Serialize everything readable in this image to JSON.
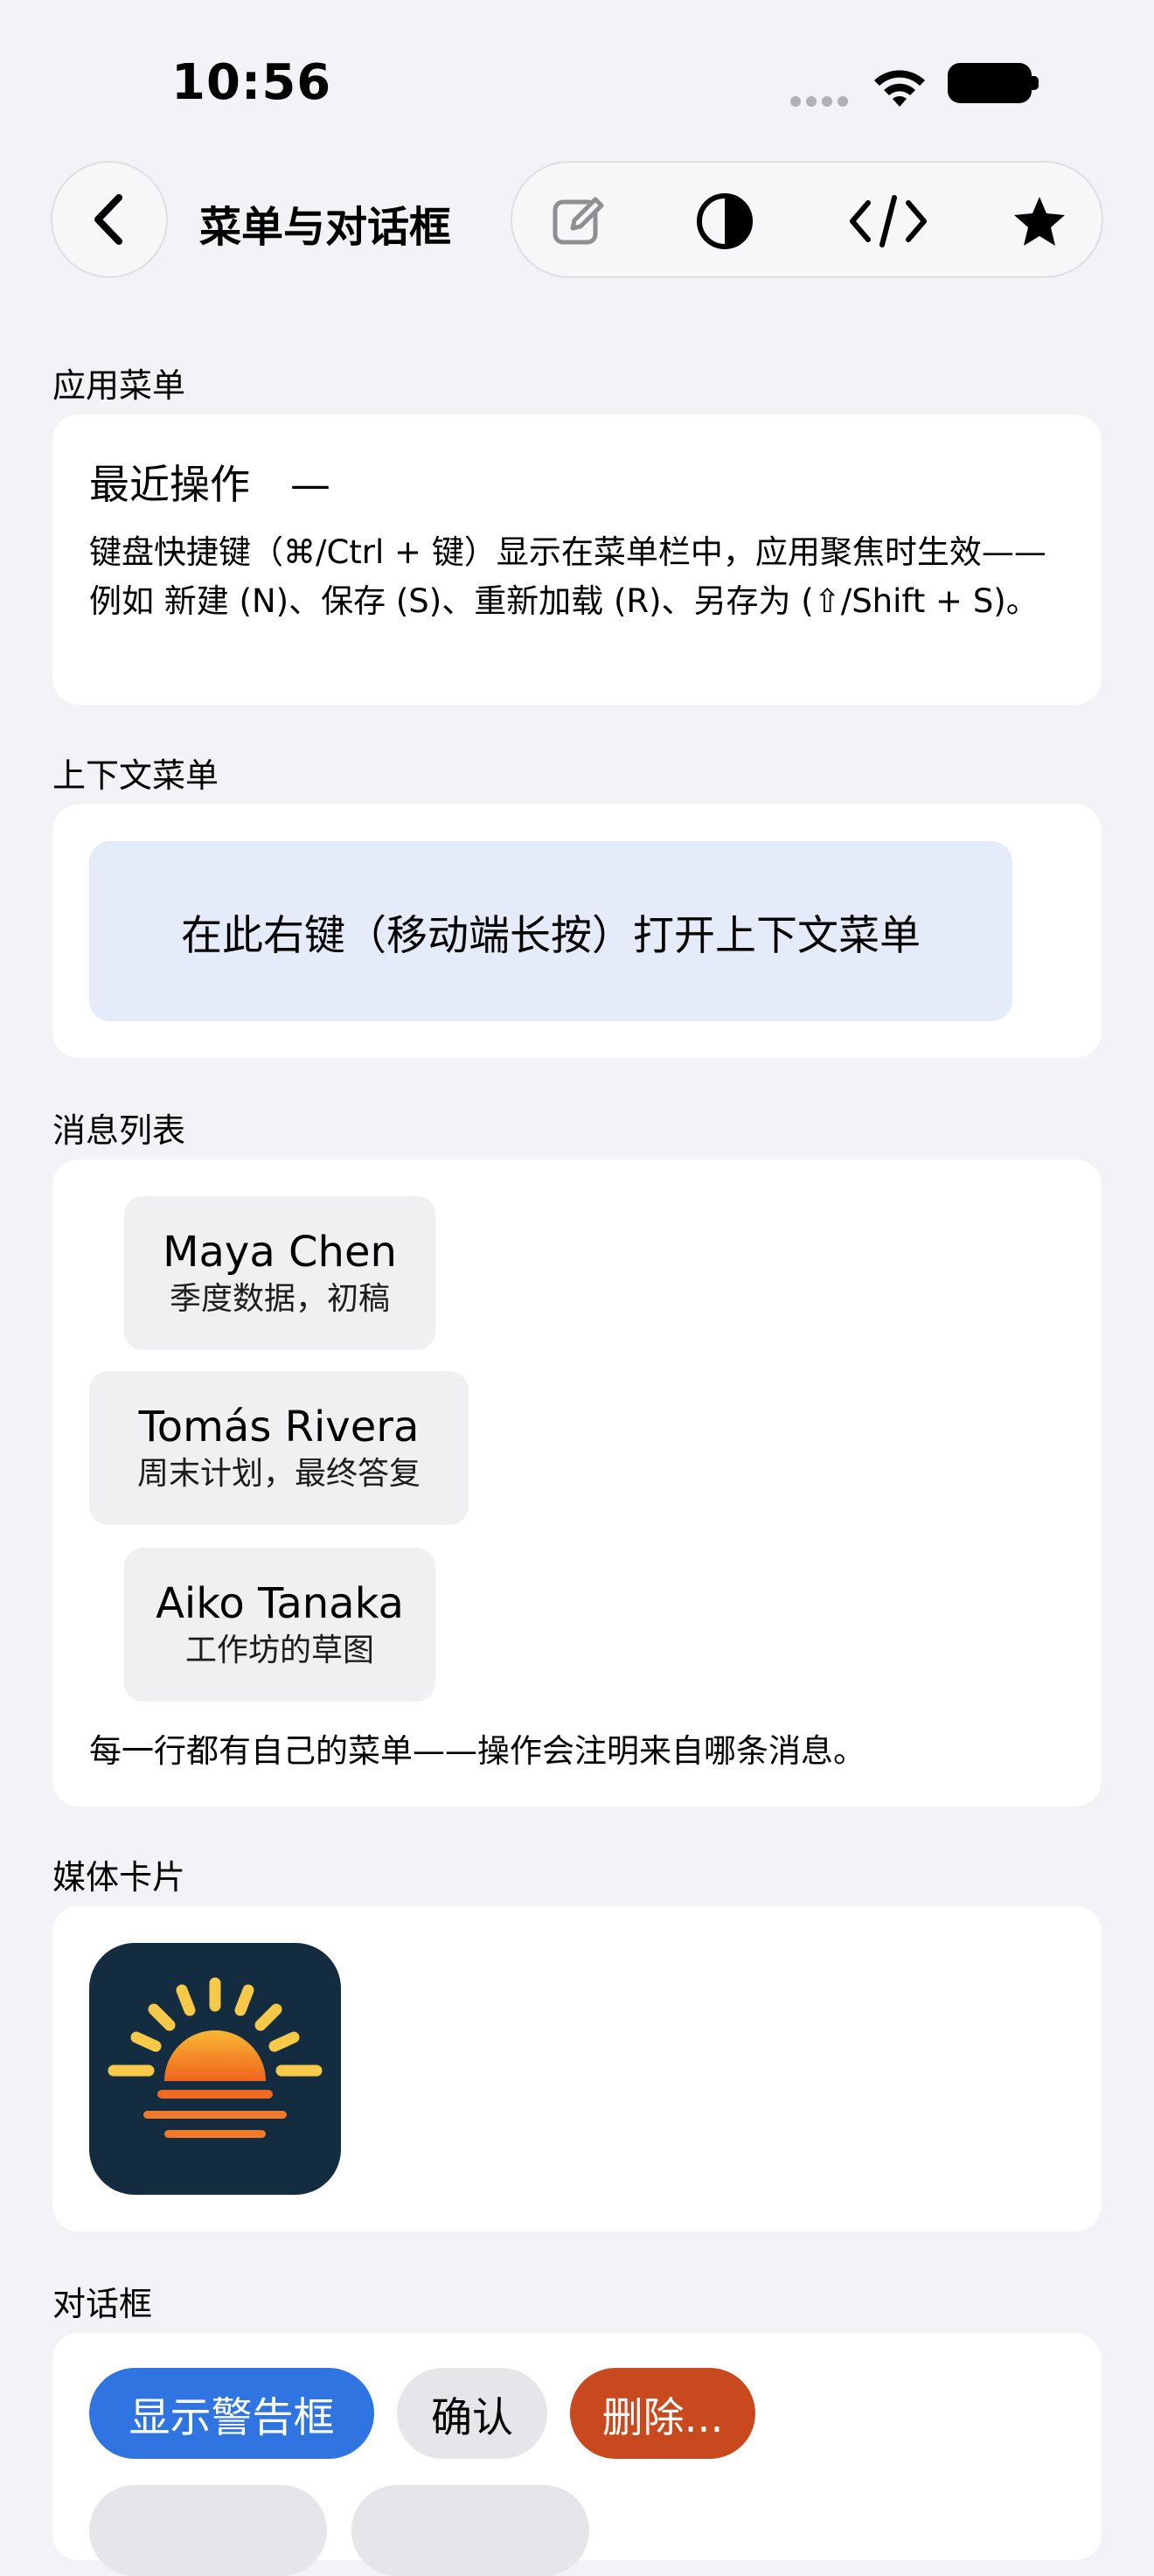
{
  "status_bar": {
    "time": "10:56"
  },
  "nav": {
    "title": "菜单与对话框",
    "back_icon": "chevron-left-icon",
    "toolbar_icons": [
      "edit-icon",
      "contrast-icon",
      "code-icon",
      "star-icon"
    ]
  },
  "sections": {
    "app_menu": {
      "label": "应用菜单",
      "recent_title": "最近操作　—",
      "description": "键盘快捷键（⌘/Ctrl + 键）显示在菜单栏中，应用聚焦时生效——例如 新建 (N)、保存 (S)、重新加载 (R)、另存为 (⇧/Shift + S)。"
    },
    "context_menu": {
      "label": "上下文菜单",
      "area_text": "在此右键（移动端长按）打开上下文菜单"
    },
    "message_list": {
      "label": "消息列表",
      "messages": [
        {
          "name": "Maya Chen",
          "subject": "季度数据，初稿"
        },
        {
          "name": "Tomás Rivera",
          "subject": "周末计划，最终答复"
        },
        {
          "name": "Aiko Tanaka",
          "subject": "工作坊的草图"
        }
      ],
      "note": "每一行都有自己的菜单——操作会注明来自哪条消息。"
    },
    "media_card": {
      "label": "媒体卡片",
      "image_icon": "sunrise-app-icon"
    },
    "dialogs": {
      "label": "对话框",
      "buttons": [
        {
          "label": "显示警告框",
          "color": "#2f74e0"
        },
        {
          "label": "确认",
          "color": "#e5e5ea"
        },
        {
          "label": "删除...",
          "color": "#c9491e"
        }
      ]
    }
  },
  "colors": {
    "background": "#f2f2f7",
    "card": "#ffffff",
    "context_area": "#e5ebf8",
    "message_bubble": "#f0f0f2",
    "media_bg": "#132c40",
    "sun_orange": "#f08a24",
    "sun_yellow": "#f7c948",
    "primary_button": "#2f74e0",
    "destructive_button": "#c9491e"
  }
}
